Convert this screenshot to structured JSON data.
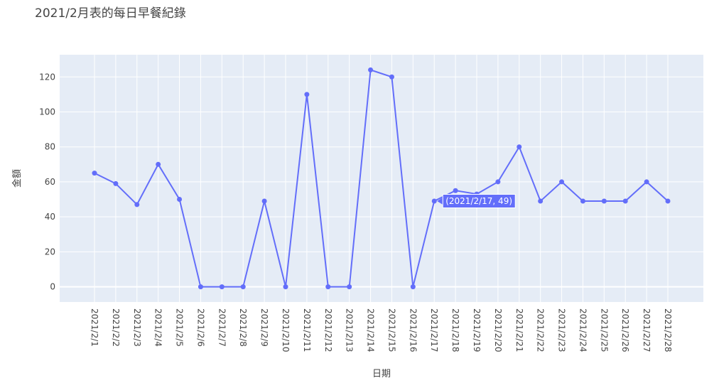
{
  "chart_data": {
    "type": "line",
    "title": "2021/2月表的每日早餐紀錄",
    "xlabel": "日期",
    "ylabel": "金額",
    "categories": [
      "2021/2/1",
      "2021/2/2",
      "2021/2/3",
      "2021/2/4",
      "2021/2/5",
      "2021/2/6",
      "2021/2/7",
      "2021/2/8",
      "2021/2/9",
      "2021/2/10",
      "2021/2/11",
      "2021/2/12",
      "2021/2/13",
      "2021/2/14",
      "2021/2/15",
      "2021/2/16",
      "2021/2/17",
      "2021/2/18",
      "2021/2/19",
      "2021/2/20",
      "2021/2/21",
      "2021/2/22",
      "2021/2/23",
      "2021/2/24",
      "2021/2/25",
      "2021/2/26",
      "2021/2/27",
      "2021/2/28"
    ],
    "values": [
      65,
      59,
      47,
      70,
      50,
      0,
      0,
      0,
      49,
      0,
      110,
      0,
      0,
      124,
      120,
      0,
      49,
      55,
      53,
      60,
      80,
      49,
      60,
      49,
      49,
      49,
      60,
      49
    ],
    "ylim": [
      -8.7,
      132.7
    ],
    "yticks": [
      0,
      20,
      40,
      60,
      80,
      100,
      120
    ],
    "grid": true,
    "line_color": "#636efa",
    "plot_bg": "#e5ecf6",
    "hover": {
      "index": 16,
      "label": "(2021/2/17, 49)"
    }
  }
}
